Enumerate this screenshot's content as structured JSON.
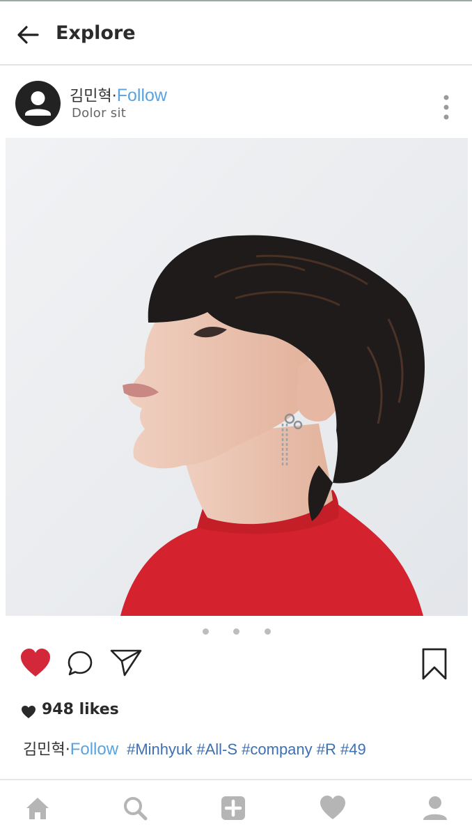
{
  "appbar": {
    "title": "Explore",
    "back_icon": "arrow-left-icon"
  },
  "post": {
    "username": "김민혁·",
    "follow_label": "Follow",
    "location": "Dolor sit",
    "avatar_icon": "user-avatar-icon",
    "more_icon": "vertical-dots-icon",
    "image_alt": "Young man with dark shaggy hair in a red mock-neck sweater looking upward, chain earring, light grey background",
    "carousel": {
      "count": 3,
      "active": 0
    },
    "actions": {
      "like_icon": "heart-filled-icon",
      "comment_icon": "comment-bubble-icon",
      "share_icon": "send-paper-plane-icon",
      "save_icon": "bookmark-icon"
    },
    "likes_text": "948 likes",
    "caption": {
      "username": "김민혁·",
      "follow_label": "Follow",
      "hashtags": "#Minhyuk #All-S #company #R #49"
    }
  },
  "bottom_nav": {
    "items": [
      "home-icon",
      "search-icon",
      "add-post-icon",
      "activity-heart-icon",
      "profile-icon"
    ]
  },
  "colors": {
    "accent_link": "#5aa3e0",
    "hashtag": "#3d6fb3",
    "like_red": "#d3283a",
    "nav_icon": "#b5b5b5"
  }
}
